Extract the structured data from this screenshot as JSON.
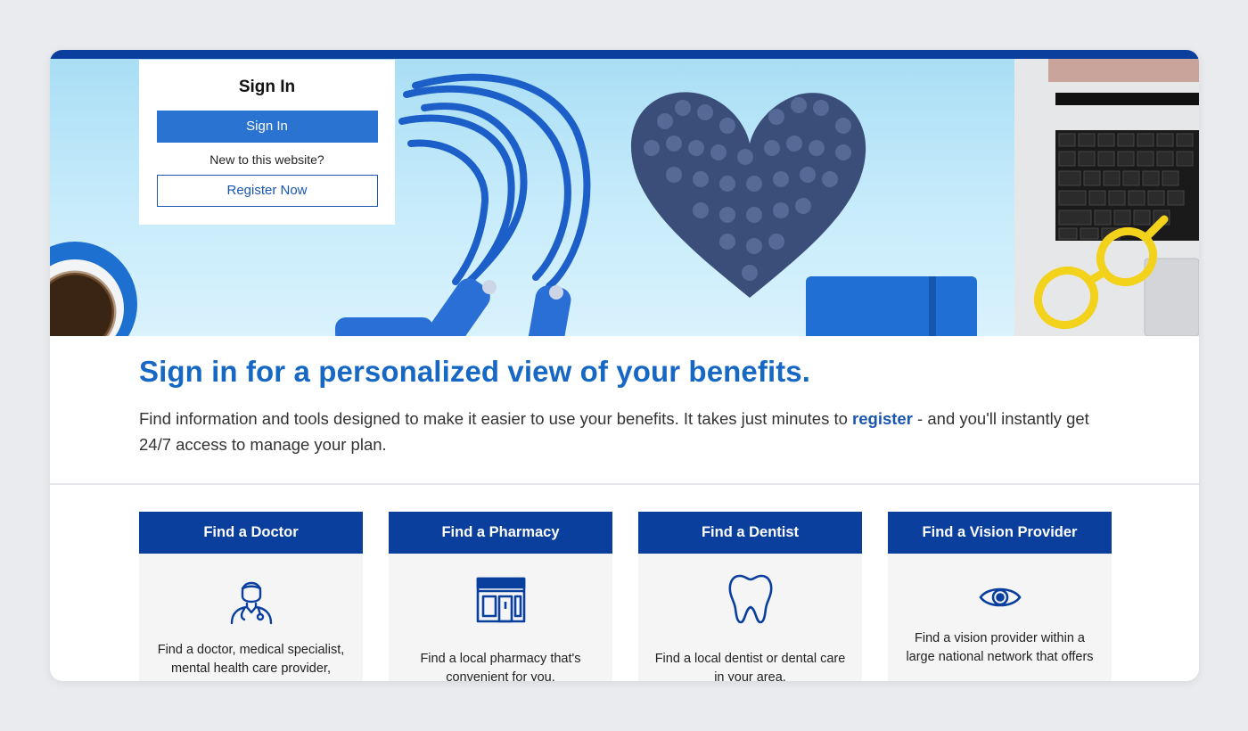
{
  "signin": {
    "title": "Sign In",
    "signin_button": "Sign In",
    "new_text": "New to this website?",
    "register_button": "Register Now"
  },
  "main": {
    "headline": "Sign in for a personalized view of your benefits.",
    "intro_before": "Find information and tools designed to make it easier to use your benefits. It takes just minutes to ",
    "intro_link": "register",
    "intro_after": " - and you'll instantly get 24/7 access to manage your plan."
  },
  "cards": [
    {
      "title": "Find a Doctor",
      "icon": "doctor-icon",
      "desc": "Find a doctor, medical specialist, mental health care provider,"
    },
    {
      "title": "Find a Pharmacy",
      "icon": "pharmacy-icon",
      "desc": "Find a local pharmacy that's convenient for you."
    },
    {
      "title": "Find a Dentist",
      "icon": "tooth-icon",
      "desc": "Find a local dentist or dental care in your area."
    },
    {
      "title": "Find a Vision Provider",
      "icon": "eye-icon",
      "desc": "Find a vision provider within a large national network that offers"
    }
  ],
  "colors": {
    "brand_blue": "#0a3f9e",
    "link_blue": "#1a55b0",
    "headline_blue": "#1668c4",
    "button_blue": "#2b73d1"
  }
}
